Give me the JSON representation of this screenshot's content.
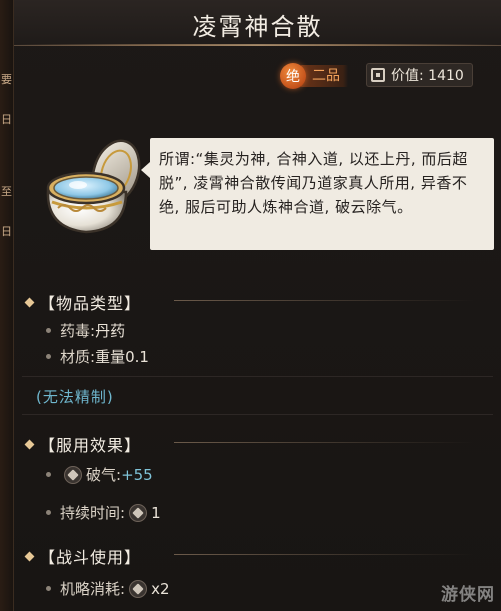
{
  "edge_chars": [
    "要",
    "日",
    "至",
    "日"
  ],
  "item": {
    "name": "凌霄神合散",
    "quality_mark": "绝",
    "quality_grade": "二品",
    "price_text": "价值: 1410",
    "description": "所谓:“集灵为神, 合神入道, 以还上丹, 而后超脱”, 凌霄神合散传闻乃道家真人所用, 异香不绝, 服后可助人炼神合道, 破云除气。"
  },
  "sections": {
    "type": {
      "title": "【物品类型】",
      "rows": [
        {
          "label": "药毒: ",
          "value": "丹药"
        },
        {
          "label": "材质: ",
          "value": "重量0.1"
        }
      ]
    },
    "refine_note": "(无法精制)",
    "effect": {
      "title": "【服用效果】",
      "rows": [
        {
          "label": "破气: ",
          "value": "+55",
          "icon": "break-qi-icon"
        },
        {
          "label": "持续时间: ",
          "value": "1",
          "icon": "duration-icon"
        }
      ]
    },
    "battle": {
      "title": "【战斗使用】",
      "rows": [
        {
          "label": "机略消耗: ",
          "value": "x2",
          "icon": "strategy-icon"
        }
      ]
    }
  },
  "watermark": "游侠网",
  "colors": {
    "quality_orange": "#e2692a",
    "value_blue": "#7fc3d8",
    "accent_gold": "#e7c896",
    "desc_bg": "#f0ebe2"
  }
}
